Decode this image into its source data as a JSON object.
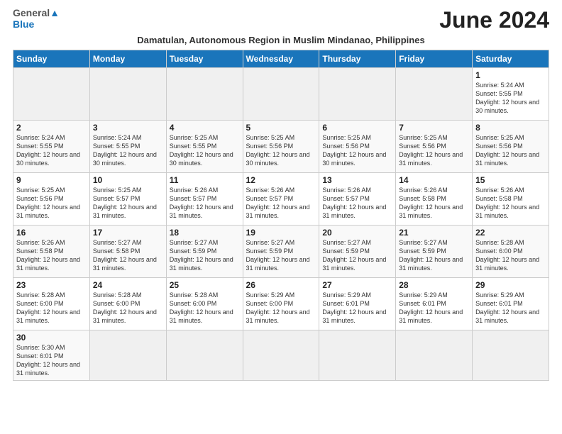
{
  "header": {
    "logo_general": "General",
    "logo_blue": "Blue",
    "month_title": "June 2024",
    "subtitle": "Damatulan, Autonomous Region in Muslim Mindanao, Philippines"
  },
  "weekdays": [
    "Sunday",
    "Monday",
    "Tuesday",
    "Wednesday",
    "Thursday",
    "Friday",
    "Saturday"
  ],
  "weeks": [
    [
      {
        "day": "",
        "info": "",
        "empty": true
      },
      {
        "day": "",
        "info": "",
        "empty": true
      },
      {
        "day": "",
        "info": "",
        "empty": true
      },
      {
        "day": "",
        "info": "",
        "empty": true
      },
      {
        "day": "",
        "info": "",
        "empty": true
      },
      {
        "day": "",
        "info": "",
        "empty": true
      },
      {
        "day": "1",
        "info": "Sunrise: 5:24 AM\nSunset: 5:55 PM\nDaylight: 12 hours and 30 minutes.",
        "empty": false
      }
    ],
    [
      {
        "day": "2",
        "info": "Sunrise: 5:24 AM\nSunset: 5:55 PM\nDaylight: 12 hours and 30 minutes.",
        "empty": false
      },
      {
        "day": "3",
        "info": "Sunrise: 5:24 AM\nSunset: 5:55 PM\nDaylight: 12 hours and 30 minutes.",
        "empty": false
      },
      {
        "day": "4",
        "info": "Sunrise: 5:25 AM\nSunset: 5:55 PM\nDaylight: 12 hours and 30 minutes.",
        "empty": false
      },
      {
        "day": "5",
        "info": "Sunrise: 5:25 AM\nSunset: 5:56 PM\nDaylight: 12 hours and 30 minutes.",
        "empty": false
      },
      {
        "day": "6",
        "info": "Sunrise: 5:25 AM\nSunset: 5:56 PM\nDaylight: 12 hours and 30 minutes.",
        "empty": false
      },
      {
        "day": "7",
        "info": "Sunrise: 5:25 AM\nSunset: 5:56 PM\nDaylight: 12 hours and 31 minutes.",
        "empty": false
      },
      {
        "day": "8",
        "info": "Sunrise: 5:25 AM\nSunset: 5:56 PM\nDaylight: 12 hours and 31 minutes.",
        "empty": false
      }
    ],
    [
      {
        "day": "9",
        "info": "Sunrise: 5:25 AM\nSunset: 5:56 PM\nDaylight: 12 hours and 31 minutes.",
        "empty": false
      },
      {
        "day": "10",
        "info": "Sunrise: 5:25 AM\nSunset: 5:57 PM\nDaylight: 12 hours and 31 minutes.",
        "empty": false
      },
      {
        "day": "11",
        "info": "Sunrise: 5:26 AM\nSunset: 5:57 PM\nDaylight: 12 hours and 31 minutes.",
        "empty": false
      },
      {
        "day": "12",
        "info": "Sunrise: 5:26 AM\nSunset: 5:57 PM\nDaylight: 12 hours and 31 minutes.",
        "empty": false
      },
      {
        "day": "13",
        "info": "Sunrise: 5:26 AM\nSunset: 5:57 PM\nDaylight: 12 hours and 31 minutes.",
        "empty": false
      },
      {
        "day": "14",
        "info": "Sunrise: 5:26 AM\nSunset: 5:58 PM\nDaylight: 12 hours and 31 minutes.",
        "empty": false
      },
      {
        "day": "15",
        "info": "Sunrise: 5:26 AM\nSunset: 5:58 PM\nDaylight: 12 hours and 31 minutes.",
        "empty": false
      }
    ],
    [
      {
        "day": "16",
        "info": "Sunrise: 5:26 AM\nSunset: 5:58 PM\nDaylight: 12 hours and 31 minutes.",
        "empty": false
      },
      {
        "day": "17",
        "info": "Sunrise: 5:27 AM\nSunset: 5:58 PM\nDaylight: 12 hours and 31 minutes.",
        "empty": false
      },
      {
        "day": "18",
        "info": "Sunrise: 5:27 AM\nSunset: 5:59 PM\nDaylight: 12 hours and 31 minutes.",
        "empty": false
      },
      {
        "day": "19",
        "info": "Sunrise: 5:27 AM\nSunset: 5:59 PM\nDaylight: 12 hours and 31 minutes.",
        "empty": false
      },
      {
        "day": "20",
        "info": "Sunrise: 5:27 AM\nSunset: 5:59 PM\nDaylight: 12 hours and 31 minutes.",
        "empty": false
      },
      {
        "day": "21",
        "info": "Sunrise: 5:27 AM\nSunset: 5:59 PM\nDaylight: 12 hours and 31 minutes.",
        "empty": false
      },
      {
        "day": "22",
        "info": "Sunrise: 5:28 AM\nSunset: 6:00 PM\nDaylight: 12 hours and 31 minutes.",
        "empty": false
      }
    ],
    [
      {
        "day": "23",
        "info": "Sunrise: 5:28 AM\nSunset: 6:00 PM\nDaylight: 12 hours and 31 minutes.",
        "empty": false
      },
      {
        "day": "24",
        "info": "Sunrise: 5:28 AM\nSunset: 6:00 PM\nDaylight: 12 hours and 31 minutes.",
        "empty": false
      },
      {
        "day": "25",
        "info": "Sunrise: 5:28 AM\nSunset: 6:00 PM\nDaylight: 12 hours and 31 minutes.",
        "empty": false
      },
      {
        "day": "26",
        "info": "Sunrise: 5:29 AM\nSunset: 6:00 PM\nDaylight: 12 hours and 31 minutes.",
        "empty": false
      },
      {
        "day": "27",
        "info": "Sunrise: 5:29 AM\nSunset: 6:01 PM\nDaylight: 12 hours and 31 minutes.",
        "empty": false
      },
      {
        "day": "28",
        "info": "Sunrise: 5:29 AM\nSunset: 6:01 PM\nDaylight: 12 hours and 31 minutes.",
        "empty": false
      },
      {
        "day": "29",
        "info": "Sunrise: 5:29 AM\nSunset: 6:01 PM\nDaylight: 12 hours and 31 minutes.",
        "empty": false
      }
    ],
    [
      {
        "day": "30",
        "info": "Sunrise: 5:30 AM\nSunset: 6:01 PM\nDaylight: 12 hours and 31 minutes.",
        "empty": false
      },
      {
        "day": "",
        "info": "",
        "empty": true
      },
      {
        "day": "",
        "info": "",
        "empty": true
      },
      {
        "day": "",
        "info": "",
        "empty": true
      },
      {
        "day": "",
        "info": "",
        "empty": true
      },
      {
        "day": "",
        "info": "",
        "empty": true
      },
      {
        "day": "",
        "info": "",
        "empty": true
      }
    ]
  ]
}
